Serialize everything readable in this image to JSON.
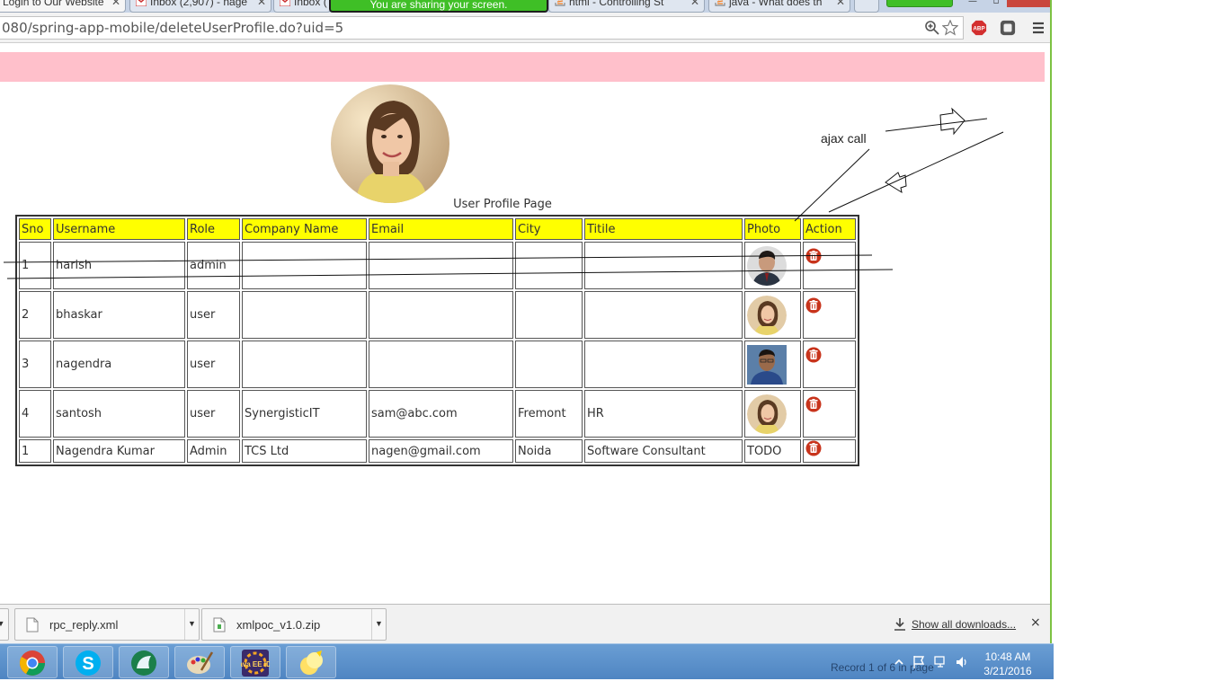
{
  "tabs": [
    {
      "label": "Login to Our Website",
      "active": true
    },
    {
      "label": "Inbox (2,907) - nage"
    },
    {
      "label": "Inbox (",
      "hidden": true
    },
    {
      "label": "html - Controlling St"
    },
    {
      "label": "java - What does th"
    }
  ],
  "share_banner": "You are sharing your screen.",
  "address_bar": {
    "url": "080/spring-app-mobile/deleteUserProfile.do?uid=5"
  },
  "page": {
    "title": "User Profile Page",
    "table": {
      "headers": [
        "Sno",
        "Username",
        "Role",
        "Company Name",
        "Email",
        "City",
        "Titile",
        "Photo",
        "Action"
      ],
      "rows": [
        {
          "sno": "1",
          "username": "harish",
          "role": "admin",
          "company": "",
          "email": "",
          "city": "",
          "title": "",
          "photo": "man-dark-suit",
          "photo_text": ""
        },
        {
          "sno": "2",
          "username": "bhaskar",
          "role": "user",
          "company": "",
          "email": "",
          "city": "",
          "title": "",
          "photo": "woman-round",
          "photo_text": ""
        },
        {
          "sno": "3",
          "username": "nagendra",
          "role": "user",
          "company": "",
          "email": "",
          "city": "",
          "title": "",
          "photo": "man-glasses",
          "photo_text": ""
        },
        {
          "sno": "4",
          "username": "santosh",
          "role": "user",
          "company": "SynergisticIT",
          "email": "sam@abc.com",
          "city": "Fremont",
          "title": "HR",
          "photo": "woman-round",
          "photo_text": ""
        },
        {
          "sno": "1",
          "username": "Nagendra Kumar",
          "role": "Admin",
          "company": "TCS Ltd",
          "email": "nagen@gmail.com",
          "city": "Noida",
          "title": "Software Consultant",
          "photo": "none",
          "photo_text": "TODO"
        }
      ]
    },
    "annotation": {
      "label": "ajax call"
    }
  },
  "downloads": {
    "items": [
      {
        "name": "rpc_reply.xml"
      },
      {
        "name": "xmlpoc_v1.0.zip"
      }
    ],
    "show_all": "Show all downloads...",
    "close": "×"
  },
  "taskbar": {
    "apps": [
      "chrome-icon",
      "skype-icon",
      "browser-app-icon",
      "paint-icon",
      "java-ee-ide-icon",
      "misc-app-icon"
    ],
    "java_label": "Java EE IDE",
    "record_status": "Record 1 of 6 in page",
    "clock_time": "10:48 AM",
    "clock_date": "3/21/2016"
  },
  "colors": {
    "header_yellow": "#ffff00",
    "pink_bar": "#ffc0cb",
    "delete_red": "#c8341c",
    "taskbar_blue": "#5a8fcb"
  }
}
